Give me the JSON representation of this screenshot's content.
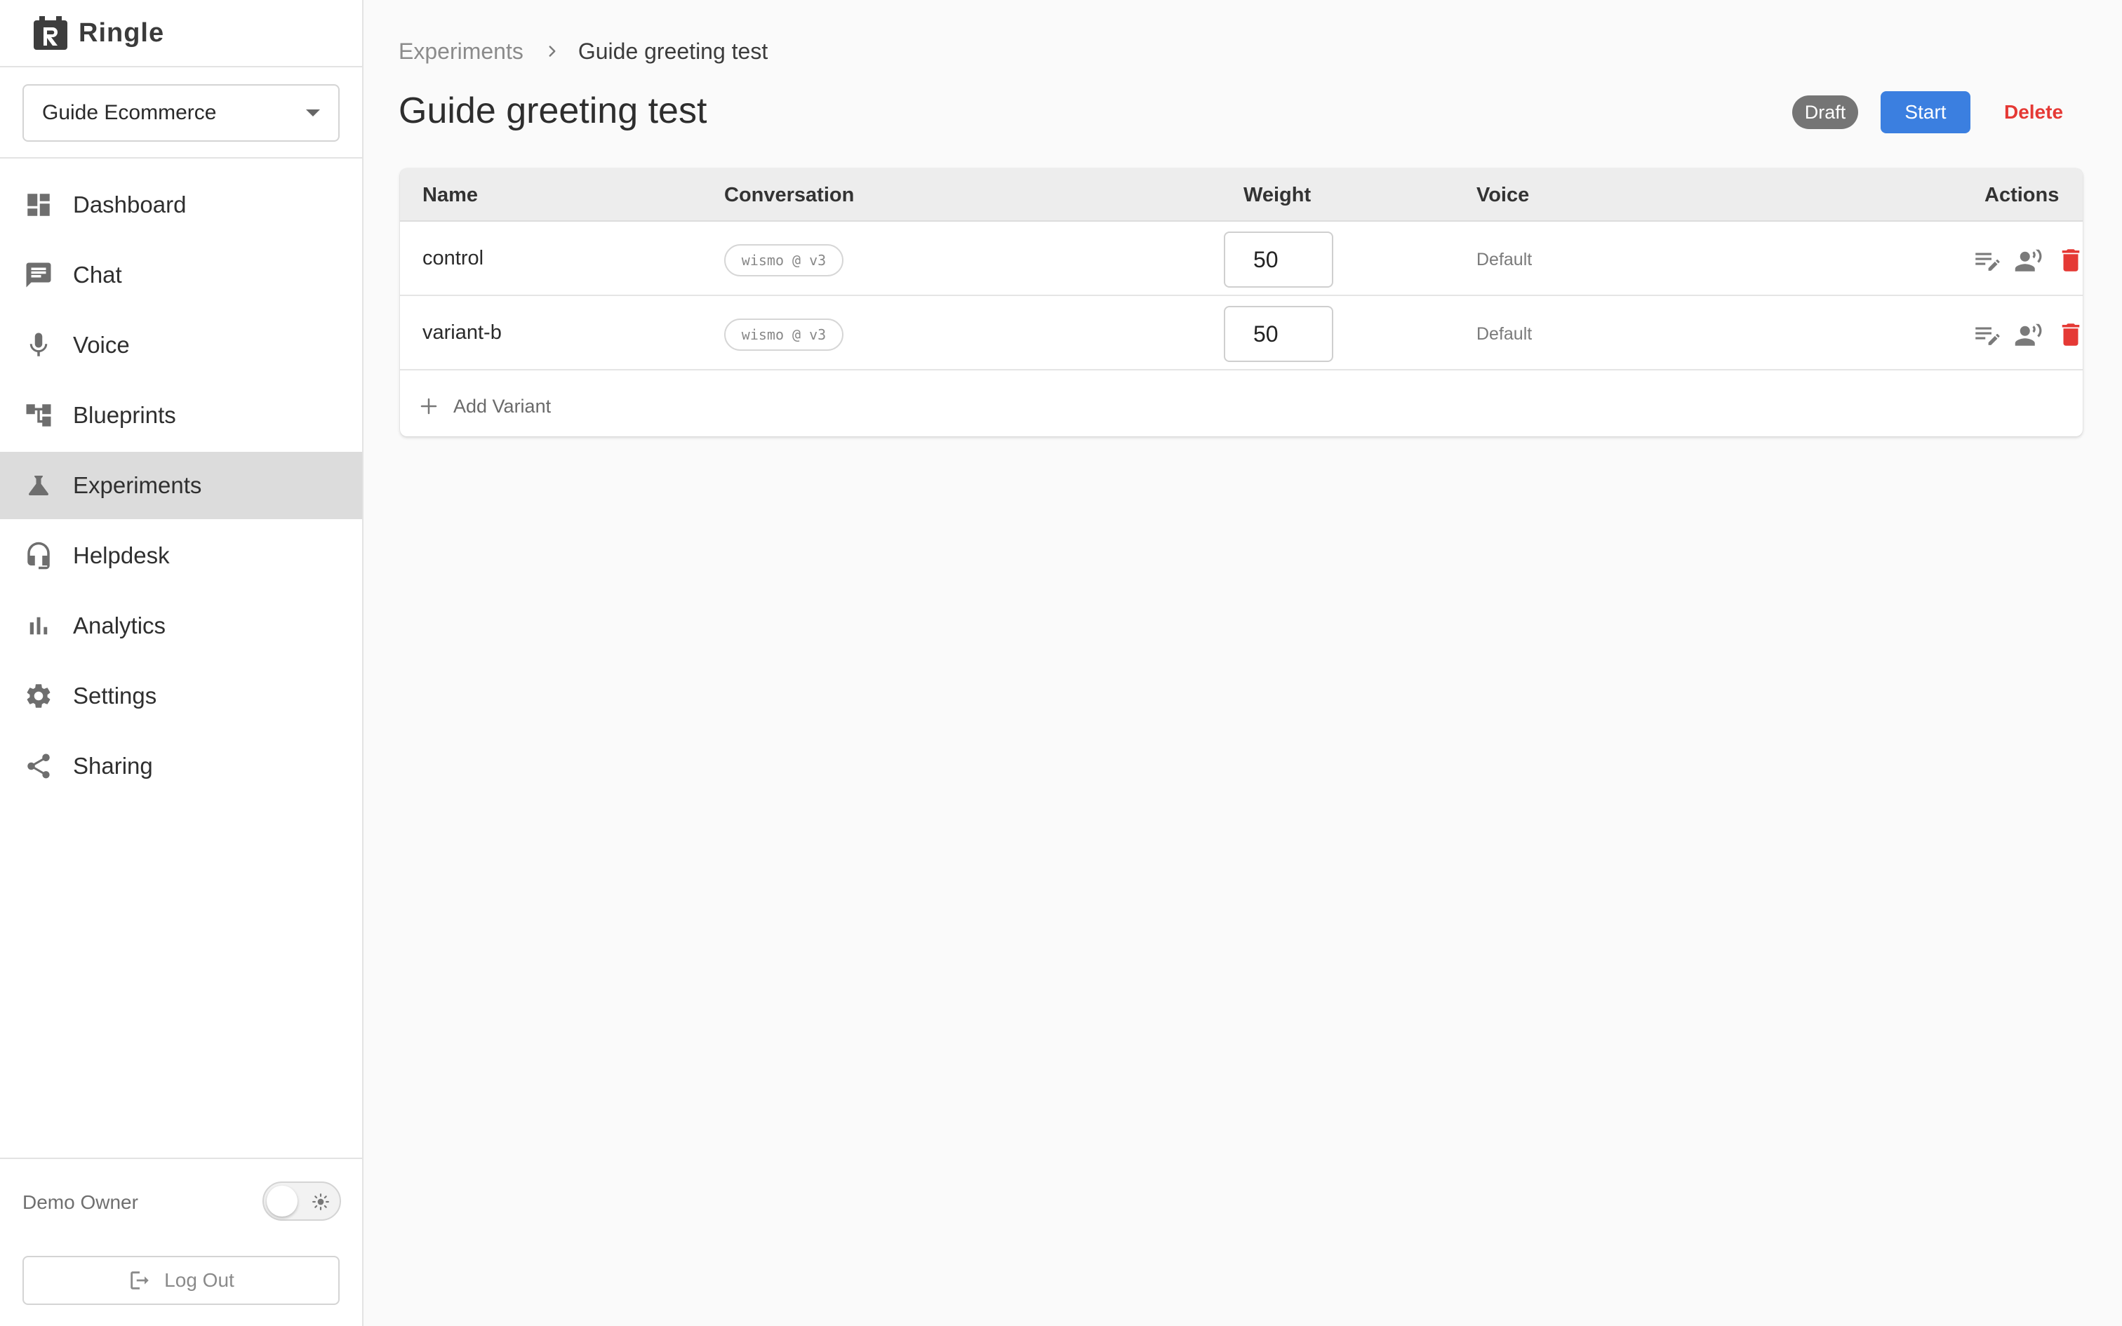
{
  "app": {
    "name": "Ringle",
    "accent": "#3b7fe0",
    "danger": "#e53935"
  },
  "sidebar": {
    "workspace": "Guide Ecommerce",
    "items": [
      {
        "label": "Dashboard",
        "icon": "dashboard-icon"
      },
      {
        "label": "Chat",
        "icon": "chat-icon"
      },
      {
        "label": "Voice",
        "icon": "microphone-icon"
      },
      {
        "label": "Blueprints",
        "icon": "blueprint-icon"
      },
      {
        "label": "Experiments",
        "icon": "flask-icon",
        "active": true
      },
      {
        "label": "Helpdesk",
        "icon": "headset-icon"
      },
      {
        "label": "Analytics",
        "icon": "bar-chart-icon"
      },
      {
        "label": "Settings",
        "icon": "gear-icon"
      },
      {
        "label": "Sharing",
        "icon": "share-icon"
      }
    ],
    "user": "Demo Owner",
    "logout_label": "Log Out"
  },
  "breadcrumb": {
    "parent": "Experiments",
    "current": "Guide greeting test"
  },
  "page": {
    "title": "Guide greeting test",
    "status": "Draft",
    "start_label": "Start",
    "delete_label": "Delete"
  },
  "table": {
    "columns": [
      "Name",
      "Conversation",
      "Weight",
      "Voice",
      "Actions"
    ],
    "rows": [
      {
        "name": "control",
        "conversation": "wismo @ v3",
        "weight": "50",
        "voice": "Default"
      },
      {
        "name": "variant-b",
        "conversation": "wismo @ v3",
        "weight": "50",
        "voice": "Default"
      }
    ],
    "add_label": "Add Variant"
  }
}
